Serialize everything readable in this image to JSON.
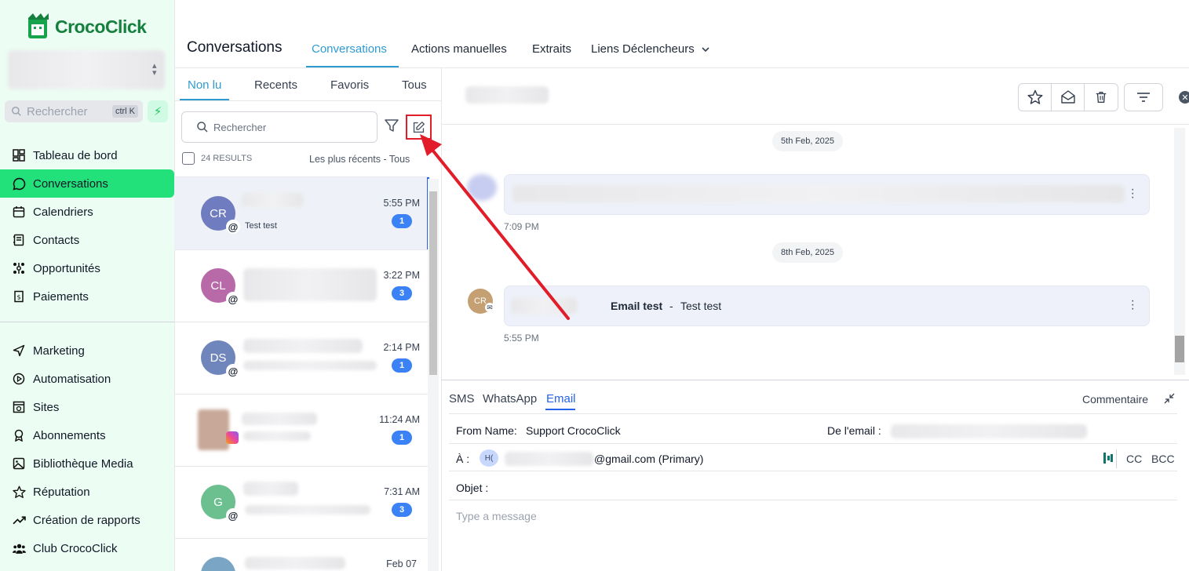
{
  "sidebar": {
    "logo": "CrocoClick",
    "search_placeholder": "Rechercher",
    "search_shortcut": "ctrl K",
    "items": [
      {
        "label": "Tableau de bord",
        "icon": "dashboard-icon"
      },
      {
        "label": "Conversations",
        "icon": "chat-icon",
        "active": true
      },
      {
        "label": "Calendriers",
        "icon": "calendar-icon"
      },
      {
        "label": "Contacts",
        "icon": "contacts-icon"
      },
      {
        "label": "Opportunités",
        "icon": "opportunities-icon"
      },
      {
        "label": "Paiements",
        "icon": "payments-icon"
      },
      {
        "label": "Marketing",
        "icon": "send-icon"
      },
      {
        "label": "Automatisation",
        "icon": "automation-icon"
      },
      {
        "label": "Sites",
        "icon": "sites-icon"
      },
      {
        "label": "Abonnements",
        "icon": "membership-icon"
      },
      {
        "label": "Bibliothèque Media",
        "icon": "media-icon"
      },
      {
        "label": "Réputation",
        "icon": "star-icon"
      },
      {
        "label": "Création de rapports",
        "icon": "reporting-icon"
      },
      {
        "label": "Club CrocoClick",
        "icon": "community-icon"
      }
    ]
  },
  "header": {
    "title": "Conversations",
    "tabs": [
      "Conversations",
      "Actions manuelles",
      "Extraits",
      "Liens Déclencheurs"
    ]
  },
  "list": {
    "filter_tabs": [
      "Non lu",
      "Recents",
      "Favoris",
      "Tous"
    ],
    "search_placeholder": "Rechercher",
    "results": "24 RESULTS",
    "sort": "Les plus récents - Tous",
    "rows": [
      {
        "initials": "CR",
        "color": "#6f7cbf",
        "time": "5:55 PM",
        "badge": "1",
        "preview": "Test test",
        "channel": "@"
      },
      {
        "initials": "CL",
        "color": "#b86aa8",
        "time": "3:22 PM",
        "badge": "3",
        "preview": "",
        "channel": "@"
      },
      {
        "initials": "DS",
        "color": "#6f86bd",
        "time": "2:14 PM",
        "badge": "1",
        "preview": "",
        "channel": "@"
      },
      {
        "initials": "",
        "color": "#c8a898",
        "time": "11:24 AM",
        "badge": "1",
        "preview": "",
        "channel": "instagram"
      },
      {
        "initials": "G",
        "color": "#6cbf8f",
        "time": "7:31 AM",
        "badge": "3",
        "preview": "",
        "channel": "@"
      },
      {
        "initials": "",
        "color": "#7aa5c4",
        "time": "Feb 07",
        "badge": "",
        "preview": "",
        "channel": ""
      }
    ]
  },
  "detail": {
    "dates": [
      "5th Feb, 2025",
      "8th Feb, 2025"
    ],
    "msg1_time": "7:09 PM",
    "msg2_avatar": "CR",
    "msg2_subject": "Email test",
    "msg2_sep": "-",
    "msg2_body": "Test test",
    "msg2_time": "5:55 PM"
  },
  "composer": {
    "tabs": [
      "SMS",
      "WhatsApp",
      "Email"
    ],
    "comment": "Commentaire",
    "from_label": "From Name:",
    "from_value": "Support CrocoClick",
    "de_label": "De l'email :",
    "to_label": "À :",
    "to_chip": "H(",
    "to_value": "@gmail.com (Primary)",
    "cc": "CC",
    "bcc": "BCC",
    "subject_label": "Objet :",
    "placeholder": "Type a message"
  },
  "colors": {
    "accent": "#2f9bd1",
    "active_nav": "#22e07a",
    "annotation": "#e11d2a"
  }
}
